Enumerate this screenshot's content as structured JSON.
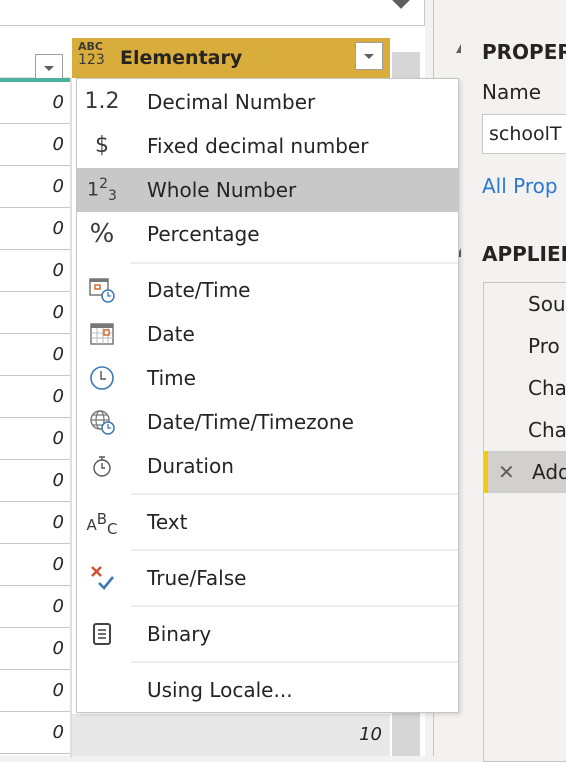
{
  "grid": {
    "column_header": "Elementary",
    "column_type_icon": {
      "top": "ABC",
      "bottom": "123"
    },
    "left_column_values": [
      "0",
      "0",
      "0",
      "0",
      "0",
      "0",
      "0",
      "0",
      "0",
      "0",
      "0",
      "0",
      "0",
      "0",
      "0",
      "0"
    ],
    "last_row_value": "10"
  },
  "type_menu": {
    "items": [
      {
        "label": "Decimal Number",
        "icon": "decimal-icon",
        "glyph": "1.2"
      },
      {
        "label": "Fixed decimal number",
        "icon": "currency-icon",
        "glyph": "$"
      },
      {
        "label": "Whole Number",
        "icon": "whole-number-icon",
        "glyph": "123",
        "highlighted": true
      },
      {
        "label": "Percentage",
        "icon": "percent-icon",
        "glyph": "%"
      },
      {
        "label": "Date/Time",
        "icon": "datetime-icon"
      },
      {
        "label": "Date",
        "icon": "calendar-icon"
      },
      {
        "label": "Time",
        "icon": "clock-icon"
      },
      {
        "label": "Date/Time/Timezone",
        "icon": "globe-clock-icon"
      },
      {
        "label": "Duration",
        "icon": "stopwatch-icon"
      },
      {
        "label": "Text",
        "icon": "text-abc-icon"
      },
      {
        "label": "True/False",
        "icon": "true-false-icon"
      },
      {
        "label": "Binary",
        "icon": "binary-icon"
      },
      {
        "label": "Using Locale...",
        "icon": ""
      }
    ]
  },
  "properties": {
    "section_title": "PROPER",
    "name_label": "Name",
    "name_value": "schoolT",
    "all_properties_link": "All Prop"
  },
  "applied_steps": {
    "section_title": "APPLIED",
    "steps": [
      "Sou",
      "Pro",
      "Cha",
      "Cha",
      "Add"
    ],
    "selected_index": 4
  },
  "colors": {
    "header_accent": "#d9ad3c",
    "teal": "#4cb2a0",
    "link": "#2b79d0",
    "step_selected": "#f2c811"
  }
}
